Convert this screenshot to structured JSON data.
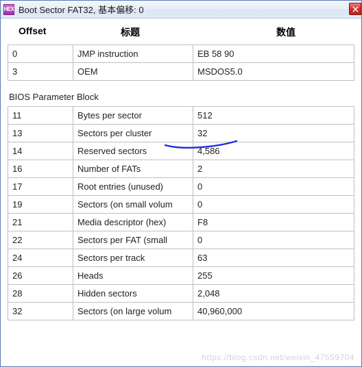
{
  "window": {
    "title": "Boot Sector FAT32, 基本偏移: 0",
    "icon_label": "HEX"
  },
  "headers": {
    "offset": "Offset",
    "title": "标题",
    "value": "数值"
  },
  "section1_rows": [
    {
      "offset": "0",
      "title": "JMP instruction",
      "value": "EB 58 90"
    },
    {
      "offset": "3",
      "title": "OEM",
      "value": "MSDOS5.0"
    }
  ],
  "section2_label": "BIOS Parameter Block",
  "section2_rows": [
    {
      "offset": "11",
      "title": "Bytes per sector",
      "value": "512"
    },
    {
      "offset": "13",
      "title": "Sectors per cluster",
      "value": "32"
    },
    {
      "offset": "14",
      "title": "Reserved sectors",
      "value": "4,586"
    },
    {
      "offset": "16",
      "title": "Number of FATs",
      "value": "2"
    },
    {
      "offset": "17",
      "title": "Root entries (unused)",
      "value": "0"
    },
    {
      "offset": "19",
      "title": "Sectors (on small volum",
      "value": "0"
    },
    {
      "offset": "21",
      "title": "Media descriptor (hex)",
      "value": "F8"
    },
    {
      "offset": "22",
      "title": "Sectors per FAT (small",
      "value": "0"
    },
    {
      "offset": "24",
      "title": "Sectors per track",
      "value": "63"
    },
    {
      "offset": "26",
      "title": "Heads",
      "value": "255"
    },
    {
      "offset": "28",
      "title": "Hidden sectors",
      "value": "2,048"
    },
    {
      "offset": "32",
      "title": "Sectors (on large volum",
      "value": "40,960,000"
    }
  ],
  "watermark": "https://blog.csdn.net/weixin_47559704"
}
